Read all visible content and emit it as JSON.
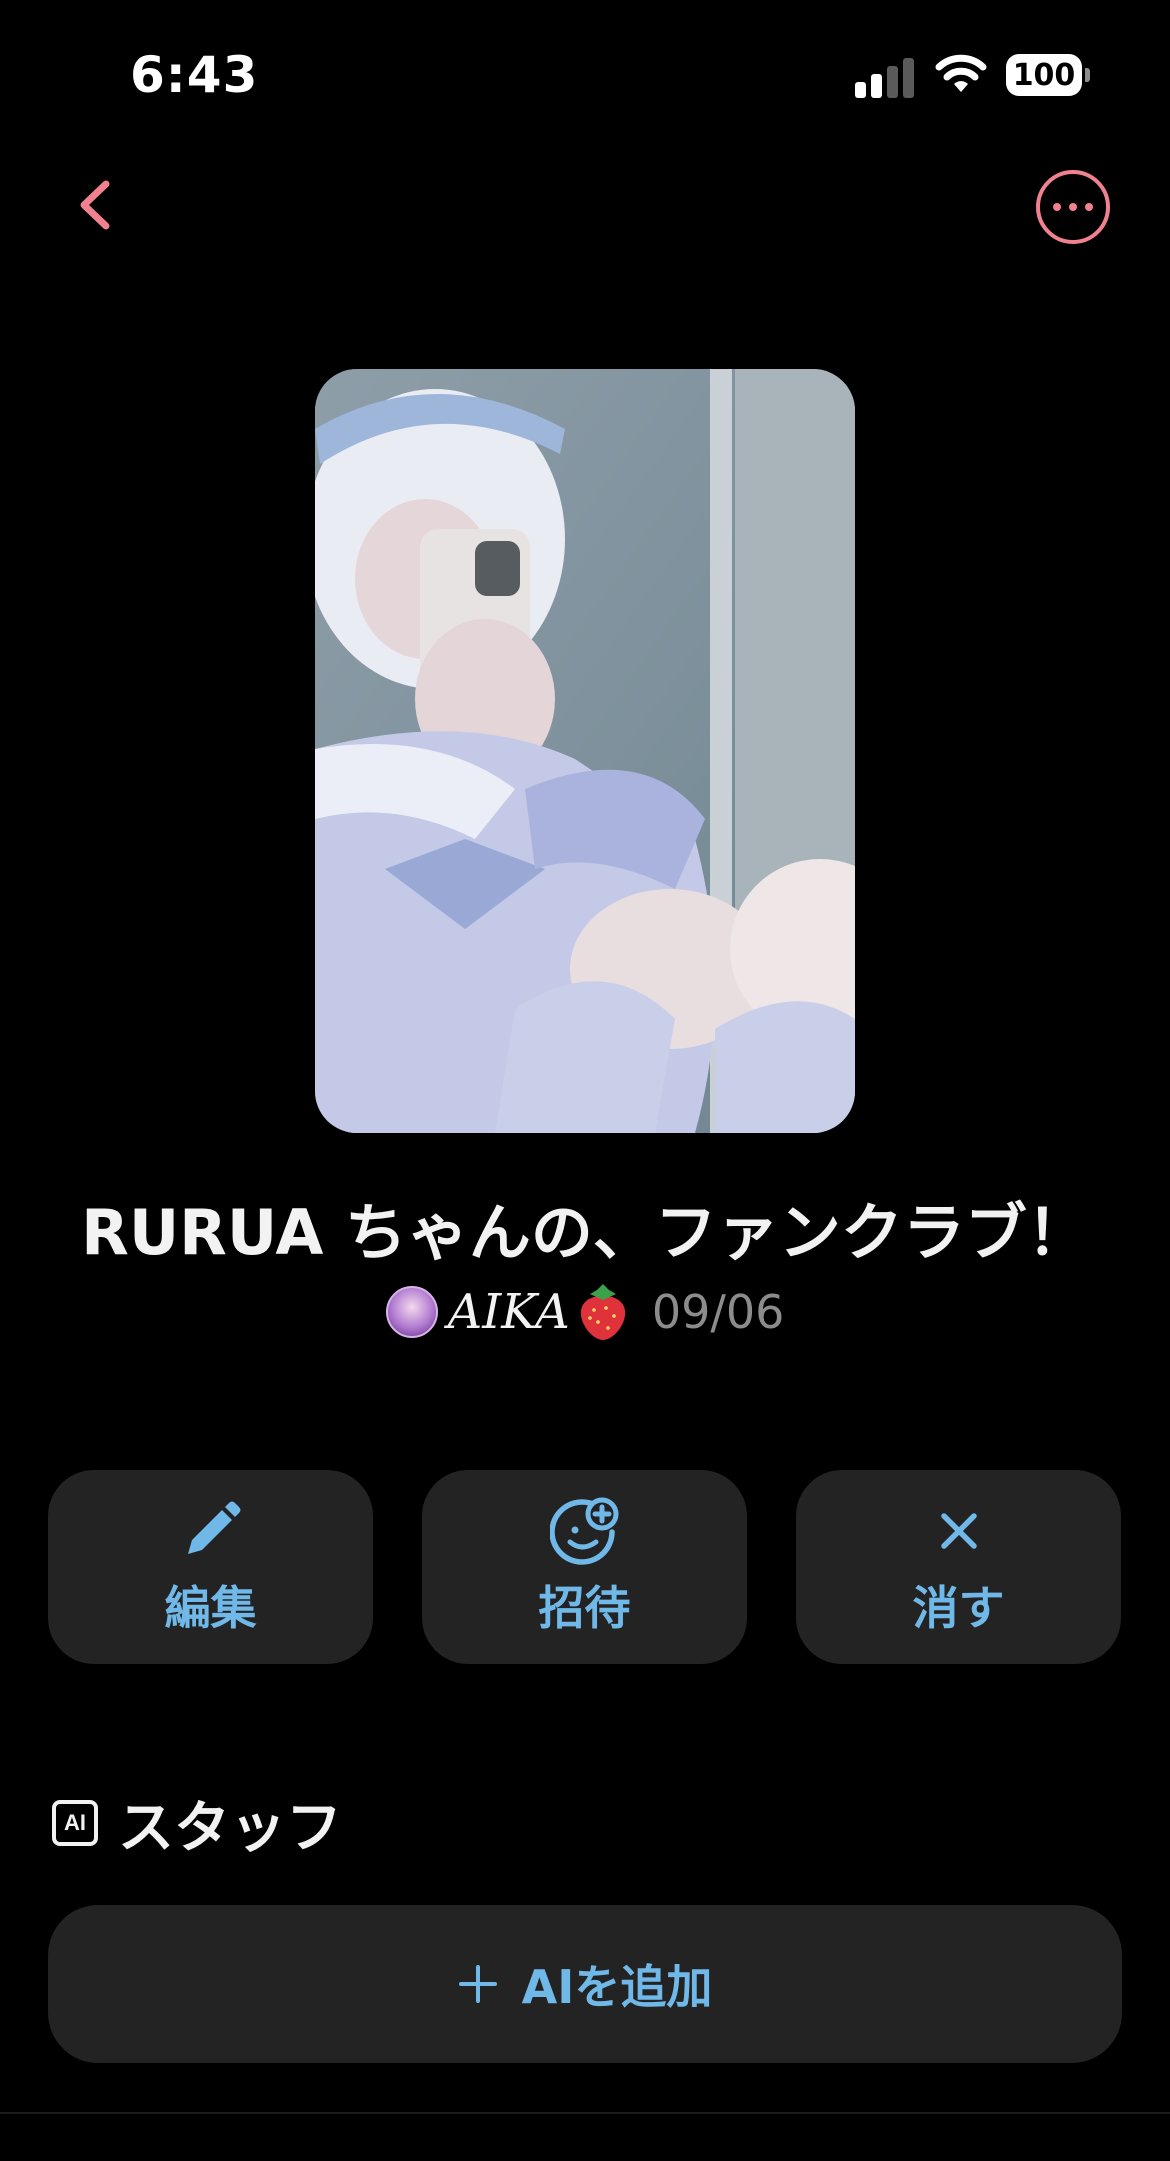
{
  "status_bar": {
    "time": "6:43",
    "battery": "100"
  },
  "nav": {
    "back_icon": "chevron-left-icon",
    "more_icon": "more-horizontal-circle-icon",
    "accent_color": "#f0828f"
  },
  "club": {
    "title": "RURUA ちゃんの、ファンクラブ！",
    "author_name": "AIKA",
    "author_emoji": "strawberry",
    "date": "09/06"
  },
  "actions": [
    {
      "label": "編集",
      "icon": "pencil-icon"
    },
    {
      "label": "招待",
      "icon": "add-person-smile-icon"
    },
    {
      "label": "消す",
      "icon": "close-icon"
    }
  ],
  "staff": {
    "badge": "AI",
    "title": "スタッフ",
    "add_button_label": "AIを追加"
  },
  "colors": {
    "background": "#000000",
    "card": "#232323",
    "action_text": "#6fb8e8",
    "date_text": "#8c8c8c"
  }
}
